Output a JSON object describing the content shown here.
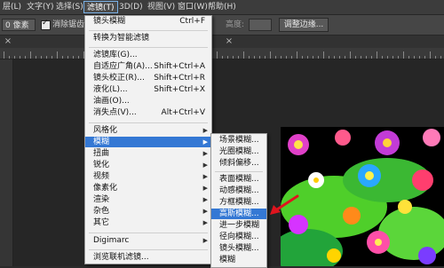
{
  "menubar": {
    "items": [
      "层(L)",
      "文字(Y)",
      "选择(S)",
      "滤镜(T)",
      "3D(D)",
      "视图(V)",
      "窗口(W)",
      "帮助(H)"
    ]
  },
  "options": {
    "feather_value": "0 像素",
    "antialias_label": "消除锯齿",
    "height_label": "高度:",
    "refine_edge_label": "调整边缘..."
  },
  "filter_menu": {
    "items": [
      {
        "label": "镜头模糊",
        "shortcut": "Ctrl+F"
      },
      {
        "label": "转换为智能滤镜"
      },
      {
        "label": "滤镜库(G)..."
      },
      {
        "label": "自适应广角(A)...",
        "shortcut": "Shift+Ctrl+A"
      },
      {
        "label": "镜头校正(R)...",
        "shortcut": "Shift+Ctrl+R"
      },
      {
        "label": "液化(L)...",
        "shortcut": "Shift+Ctrl+X"
      },
      {
        "label": "油画(O)..."
      },
      {
        "label": "消失点(V)...",
        "shortcut": "Alt+Ctrl+V"
      },
      {
        "label": "风格化"
      },
      {
        "label": "模糊"
      },
      {
        "label": "扭曲"
      },
      {
        "label": "锐化"
      },
      {
        "label": "视频"
      },
      {
        "label": "像素化"
      },
      {
        "label": "渲染"
      },
      {
        "label": "杂色"
      },
      {
        "label": "其它"
      },
      {
        "label": "Digimarc"
      },
      {
        "label": "浏览联机滤镜..."
      }
    ]
  },
  "blur_menu": {
    "items": [
      "场景模糊...",
      "光圈模糊...",
      "倾斜偏移...",
      "表面模糊...",
      "动感模糊...",
      "方框模糊...",
      "高斯模糊...",
      "进一步模糊",
      "径向模糊...",
      "镜头模糊...",
      "模糊"
    ]
  },
  "colors": {
    "highlight": "#3478d4",
    "menu_bg": "#f2f2f2",
    "ui_dark": "#2b2b2b",
    "pointer": "#e0141e"
  }
}
